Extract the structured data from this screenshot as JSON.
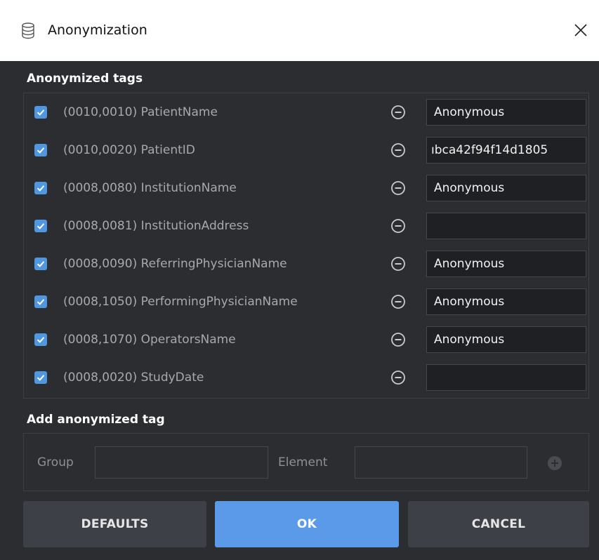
{
  "window": {
    "title": "Anonymization"
  },
  "anonymized_tags": {
    "heading": "Anonymized tags",
    "rows": [
      {
        "checked": true,
        "tag": "(0010,0010) PatientName",
        "value": "Anonymous"
      },
      {
        "checked": true,
        "tag": "(0010,0020) PatientID",
        "value": "ıbca42f94f14d1805"
      },
      {
        "checked": true,
        "tag": "(0008,0080) InstitutionName",
        "value": "Anonymous"
      },
      {
        "checked": true,
        "tag": "(0008,0081) InstitutionAddress",
        "value": ""
      },
      {
        "checked": true,
        "tag": "(0008,0090) ReferringPhysicianName",
        "value": "Anonymous"
      },
      {
        "checked": true,
        "tag": "(0008,1050) PerformingPhysicianName",
        "value": "Anonymous"
      },
      {
        "checked": true,
        "tag": "(0008,1070) OperatorsName",
        "value": "Anonymous"
      },
      {
        "checked": true,
        "tag": "(0008,0020) StudyDate",
        "value": ""
      }
    ]
  },
  "add_tag": {
    "heading": "Add anonymized tag",
    "group_label": "Group",
    "group_value": "",
    "element_label": "Element",
    "element_value": ""
  },
  "buttons": {
    "defaults": "DEFAULTS",
    "ok": "OK",
    "cancel": "CANCEL"
  },
  "colors": {
    "accent": "#5b9ae8",
    "checkbox": "#4f97e0",
    "background": "#2b2d31",
    "button": "#3d4046"
  },
  "icons": {
    "title": "database-icon",
    "close": "close-icon",
    "remove": "minus-circle-icon",
    "add": "plus-circle-icon",
    "check": "checkmark-icon"
  }
}
